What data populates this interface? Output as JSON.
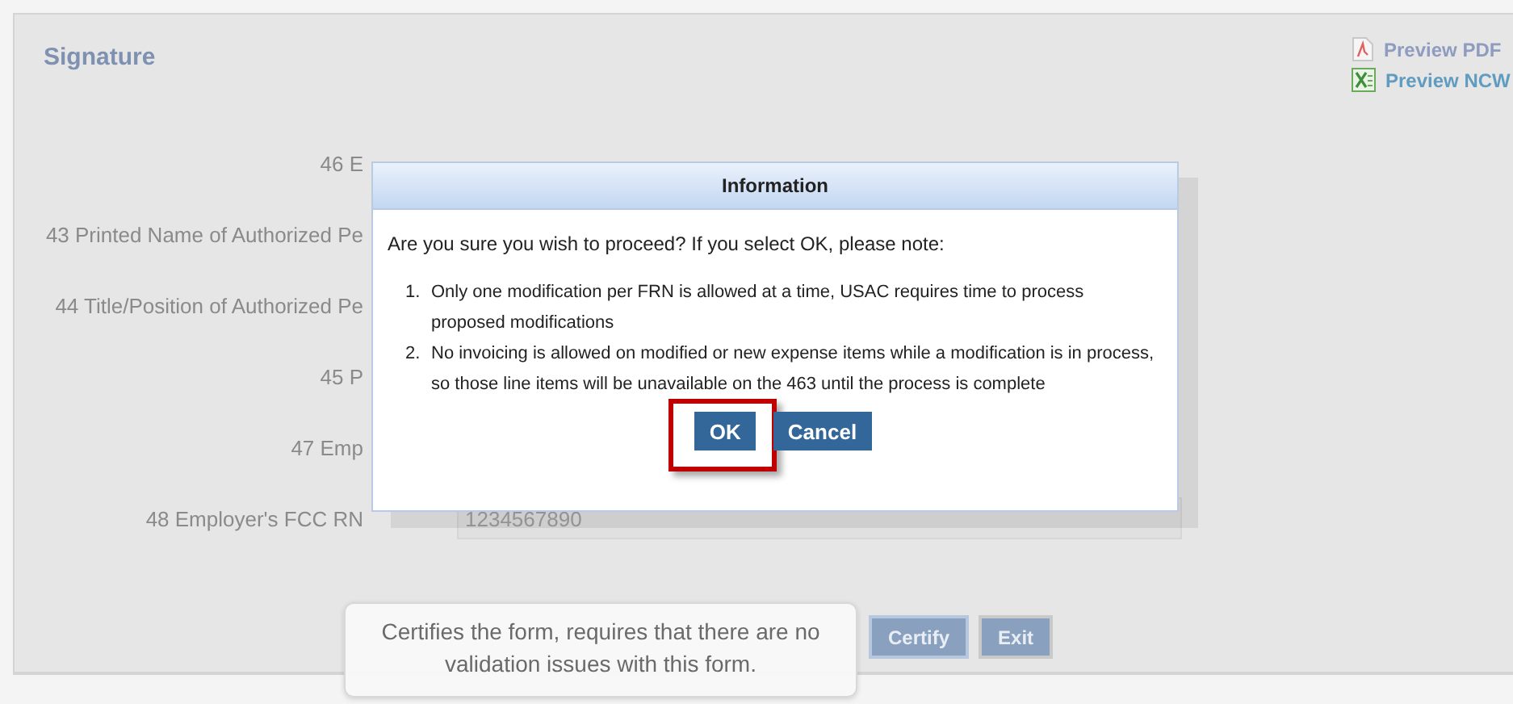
{
  "section": {
    "title": "Signature"
  },
  "links": [
    {
      "kind": "pdf",
      "label": "Preview PDF"
    },
    {
      "kind": "excel",
      "label": "Preview NCW"
    }
  ],
  "fields": [
    {
      "label": "46 E"
    },
    {
      "label": "43 Printed Name of Authorized Pe"
    },
    {
      "label": "44 Title/Position of Authorized Pe"
    },
    {
      "label": "45 P"
    },
    {
      "label": "47 Emp"
    },
    {
      "label": "48 Employer's FCC RN",
      "value": "1234567890"
    }
  ],
  "buttons": [
    {
      "label": "Certify",
      "focused": true
    },
    {
      "label": "Exit",
      "focused": false
    }
  ],
  "tooltip": "Certifies the form, requires that there are no validation issues with this form.",
  "dialog": {
    "title": "Information",
    "message": "Are you sure you wish to proceed? If you select OK, please note:",
    "notes": [
      {
        "marker": "1.",
        "text": "Only one modification per FRN is allowed at a time, USAC requires time to process proposed modifications"
      },
      {
        "marker": "2.",
        "text": "No invoicing is allowed on modified or new expense items while a modification is in process, so those line items will be unavailable on the 463 until the process is complete"
      }
    ],
    "buttons": [
      {
        "label": "OK",
        "highlighted": true
      },
      {
        "label": "Cancel",
        "highlighted": false
      }
    ]
  }
}
